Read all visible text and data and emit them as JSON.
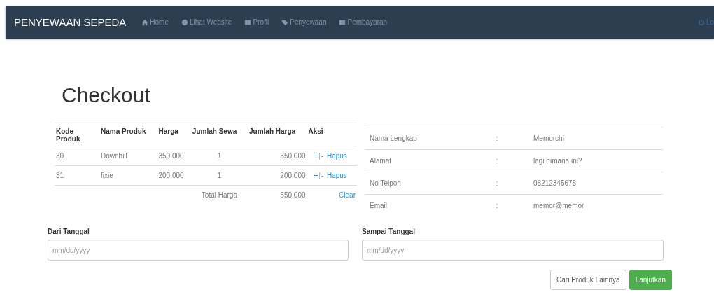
{
  "navbar": {
    "brand": "PENYEWAAN SEPEDA",
    "items": [
      {
        "label": "Home"
      },
      {
        "label": "Lihat Website"
      },
      {
        "label": "Profil"
      },
      {
        "label": "Penyewaan"
      },
      {
        "label": "Pembayaran"
      }
    ],
    "right": {
      "label": "Lo"
    }
  },
  "title": "Checkout",
  "cart": {
    "columns": [
      "Kode Produk",
      "Nama Produk",
      "Harga",
      "Jumlah Sewa",
      "Jumlah Harga",
      "Aksi"
    ],
    "rows": [
      {
        "code": "30",
        "name": "Downhill",
        "price": "350,000",
        "qty": "1",
        "total": "350,000",
        "plus": "+",
        "divider": "|",
        "minus": "-",
        "divider_2": "|",
        "remove": "Hapus"
      },
      {
        "code": "31",
        "name": "fixie",
        "price": "200,000",
        "qty": "1",
        "total": "200,000",
        "plus": "+",
        "divider": "|",
        "minus": "-",
        "divider_2": "|",
        "remove": "Hapus"
      }
    ],
    "total_label": "Total Harga",
    "total_value": "550,000",
    "clear": "Clear"
  },
  "customer": [
    {
      "label": "Nama Lengkap",
      "sep": ":",
      "value": "Memorchi"
    },
    {
      "label": "Alamat",
      "sep": ":",
      "value": "lagi dimana ini?"
    },
    {
      "label": "No Telpon",
      "sep": ":",
      "value": "08212345678"
    },
    {
      "label": "Email",
      "sep": ":",
      "value": "memor@memor"
    }
  ],
  "dates": [
    {
      "label": "Dari Tanggal",
      "placeholder": "mm/dd/yyyy"
    },
    {
      "label": "Sampai Tanggal",
      "placeholder": "mm/dd/yyyy"
    }
  ],
  "buttons": [
    {
      "kind": "default",
      "label": "Cari Produk Lainnya"
    },
    {
      "kind": "success",
      "label": "Lanjutkan"
    }
  ]
}
